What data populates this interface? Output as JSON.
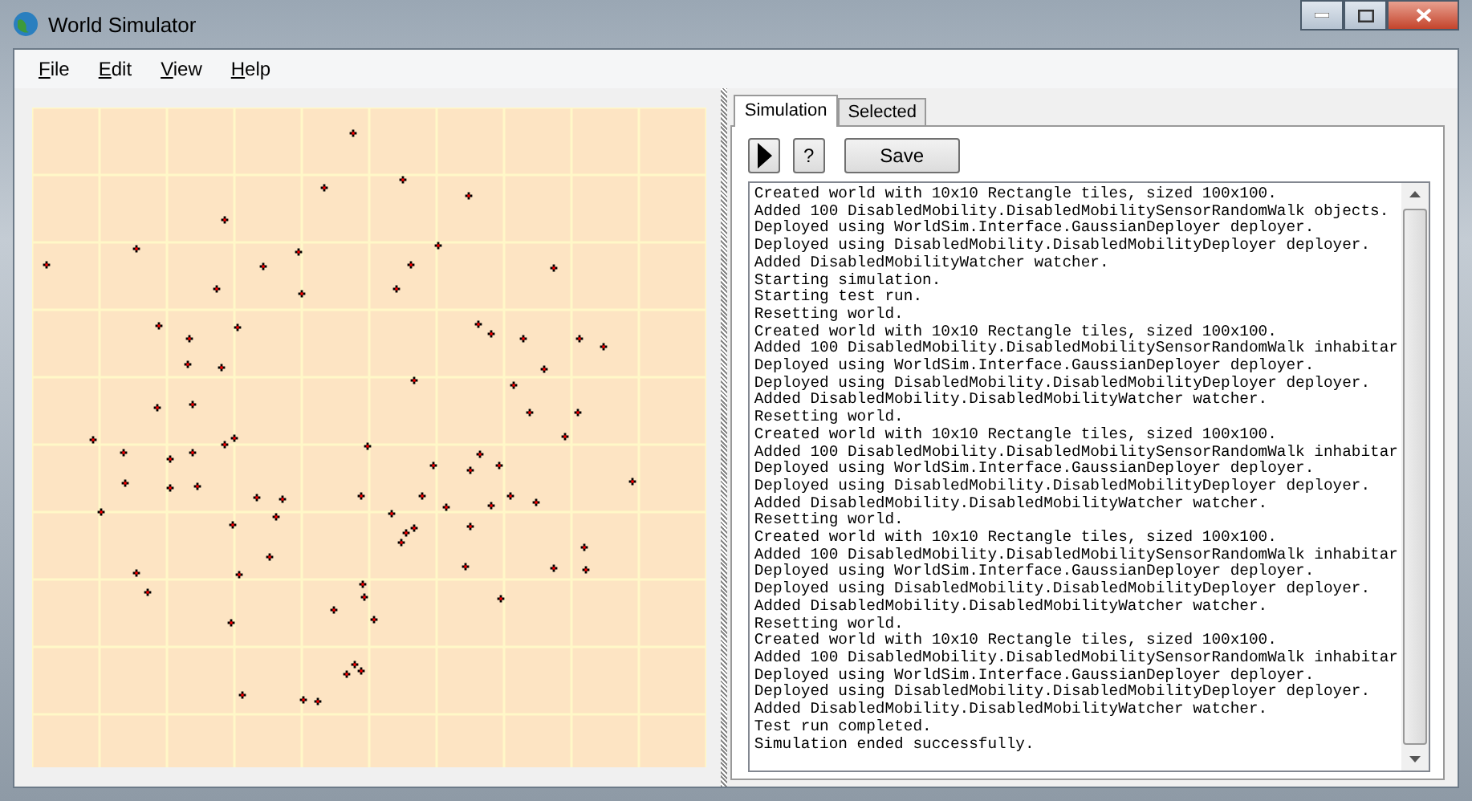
{
  "window": {
    "title": "World Simulator"
  },
  "menu": [
    {
      "label": "File"
    },
    {
      "label": "Edit"
    },
    {
      "label": "View"
    },
    {
      "label": "Help"
    }
  ],
  "tabs": [
    {
      "label": "Simulation",
      "selected": true
    },
    {
      "label": "Selected",
      "selected": false
    }
  ],
  "toolbar": {
    "help": "?",
    "save": "Save"
  },
  "log": [
    "Created world with 10x10 Rectangle tiles, sized 100x100.",
    "Added 100 DisabledMobility.DisabledMobilitySensorRandomWalk objects.",
    "Deployed using WorldSim.Interface.GaussianDeployer deployer.",
    "Deployed using DisabledMobility.DisabledMobilityDeployer deployer.",
    "Added DisabledMobilityWatcher watcher.",
    "Starting simulation.",
    "Starting test run.",
    "Resetting world.",
    "Created world with 10x10 Rectangle tiles, sized 100x100.",
    "Added 100 DisabledMobility.DisabledMobilitySensorRandomWalk inhabitar",
    "Deployed using WorldSim.Interface.GaussianDeployer deployer.",
    "Deployed using DisabledMobility.DisabledMobilityDeployer deployer.",
    "Added DisabledMobility.DisabledMobilityWatcher watcher.",
    "Resetting world.",
    "Created world with 10x10 Rectangle tiles, sized 100x100.",
    "Added 100 DisabledMobility.DisabledMobilitySensorRandomWalk inhabitar",
    "Deployed using WorldSim.Interface.GaussianDeployer deployer.",
    "Deployed using DisabledMobility.DisabledMobilityDeployer deployer.",
    "Added DisabledMobility.DisabledMobilityWatcher watcher.",
    "Resetting world.",
    "Created world with 10x10 Rectangle tiles, sized 100x100.",
    "Added 100 DisabledMobility.DisabledMobilitySensorRandomWalk inhabitar",
    "Deployed using WorldSim.Interface.GaussianDeployer deployer.",
    "Deployed using DisabledMobility.DisabledMobilityDeployer deployer.",
    "Added DisabledMobility.DisabledMobilityWatcher watcher.",
    "Resetting world.",
    "Created world with 10x10 Rectangle tiles, sized 100x100.",
    "Added 100 DisabledMobility.DisabledMobilitySensorRandomWalk inhabitar",
    "Deployed using WorldSim.Interface.GaussianDeployer deployer.",
    "Deployed using DisabledMobility.DisabledMobilityDeployer deployer.",
    "Added DisabledMobility.DisabledMobilityWatcher watcher.",
    "Test run completed.",
    "Simulation ended successfully."
  ]
}
